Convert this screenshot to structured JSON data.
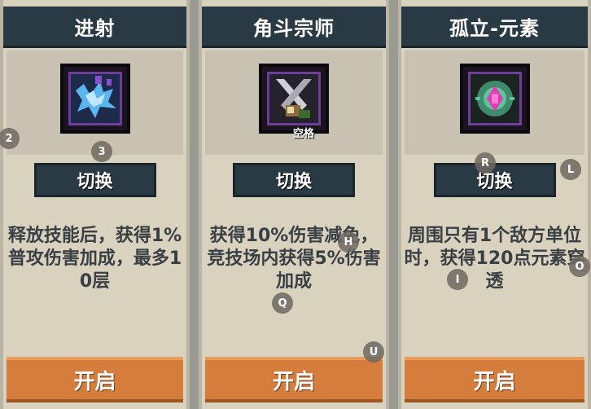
{
  "cards": [
    {
      "title": "进射",
      "switch_label": "切换",
      "description": "释放技能后，获得1%普攻伤害加成，最多10层",
      "open_label": "开启",
      "icon": "blue-burst-icon"
    },
    {
      "title": "角斗宗师",
      "switch_label": "切换",
      "description": "获得10%伤害减免，竞技场内获得5%伤害加成",
      "open_label": "开启",
      "key_label": "空格",
      "icon": "crossed-swords-icon"
    },
    {
      "title": "孤立-元素",
      "switch_label": "切换",
      "description": "周围只有1个敌方单位时，获得120点元素穿透",
      "open_label": "开启",
      "icon": "magenta-gem-icon"
    }
  ],
  "hints": [
    "2",
    "3",
    "H",
    "Q",
    "U",
    "R",
    "L",
    "I",
    "O"
  ],
  "colors": {
    "header": "#2a3a44",
    "button": "#2a3a44",
    "open": "#d47d3c",
    "card": "#d8d2bf",
    "frame_border": "#6b3f9a"
  }
}
